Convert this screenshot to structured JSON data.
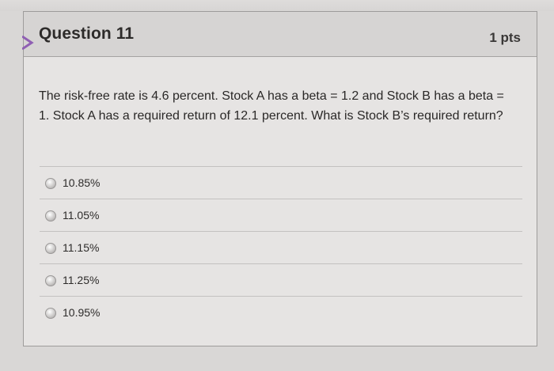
{
  "question": {
    "title": "Question 11",
    "points": "1 pts",
    "text": "The risk-free rate is 4.6 percent. Stock A has a beta = 1.2 and Stock B has a beta = 1. Stock A has a required return of 12.1 percent. What is Stock B’s required return?"
  },
  "answers": [
    {
      "label": "10.85%"
    },
    {
      "label": "11.05%"
    },
    {
      "label": "11.15%"
    },
    {
      "label": "11.25%"
    },
    {
      "label": "10.95%"
    }
  ],
  "icons": {
    "nav": "chevron-right-icon",
    "radio": "radio-button-icon"
  },
  "colors": {
    "header_bg": "#d6d4d3",
    "card_bg": "#e6e4e3",
    "text": "#2d2b2a"
  }
}
